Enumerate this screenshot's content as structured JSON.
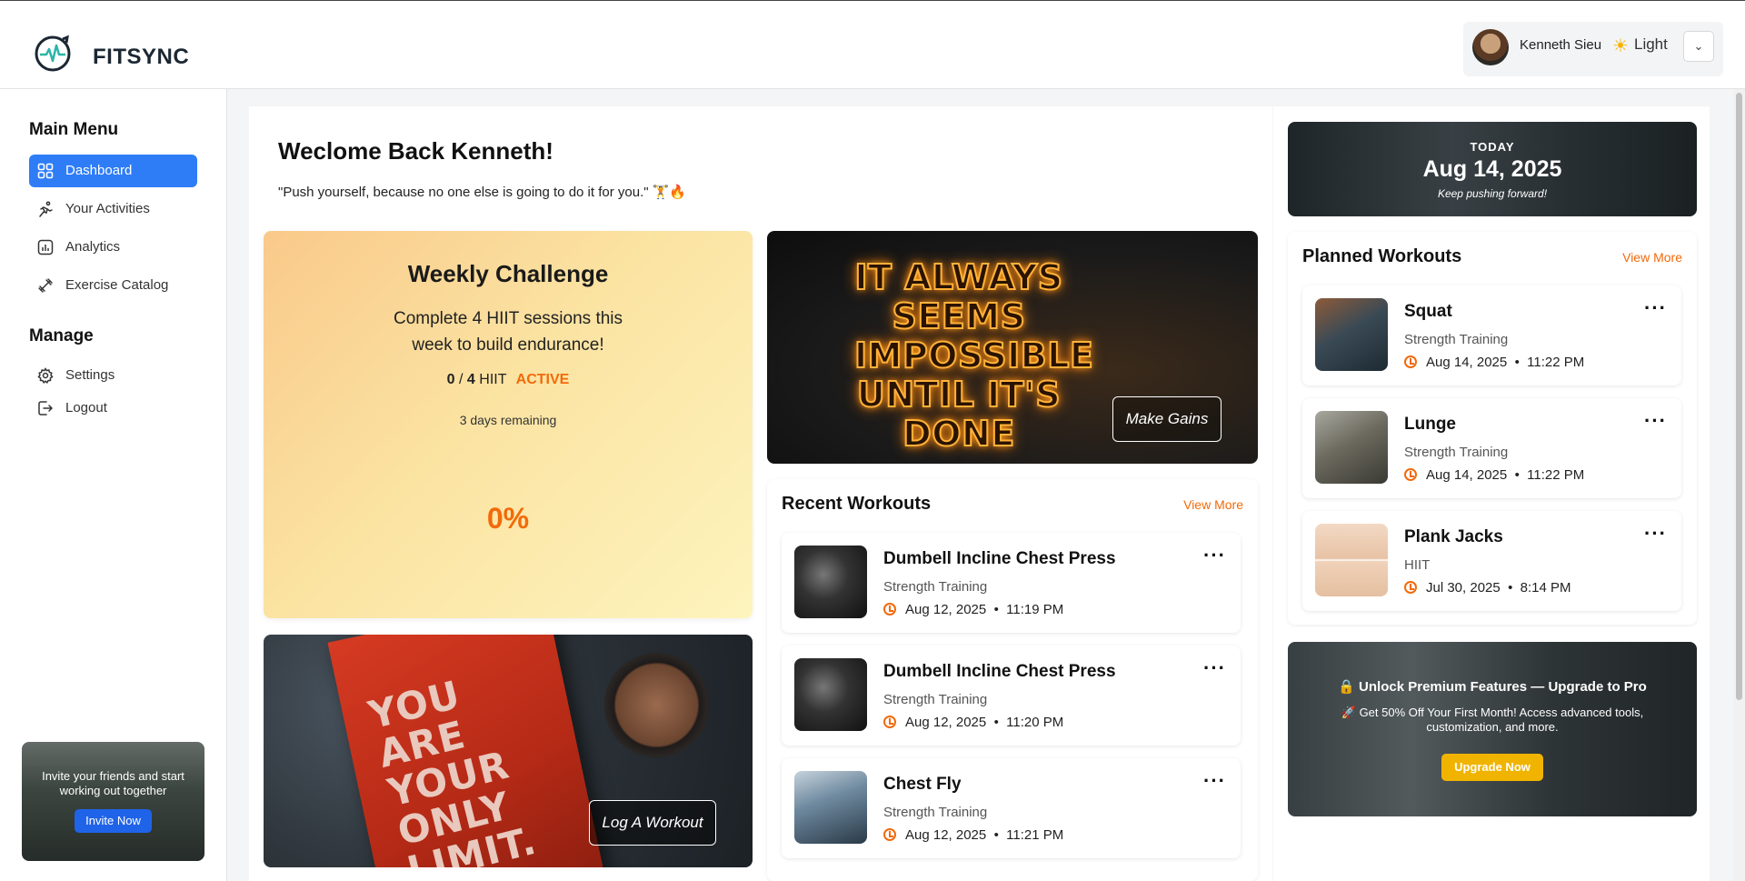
{
  "app": {
    "brand": "FITSYNC"
  },
  "user": {
    "name": "Kenneth Sieu",
    "theme_label": "Light"
  },
  "sidebar": {
    "main_heading": "Main Menu",
    "main_items": [
      {
        "label": "Dashboard",
        "icon": "grid-icon",
        "active": true
      },
      {
        "label": "Your Activities",
        "icon": "running-icon"
      },
      {
        "label": "Analytics",
        "icon": "analytics-icon"
      },
      {
        "label": "Exercise Catalog",
        "icon": "dumbbell-icon"
      }
    ],
    "manage_heading": "Manage",
    "manage_items": [
      {
        "label": "Settings",
        "icon": "gear-icon"
      },
      {
        "label": "Logout",
        "icon": "logout-icon"
      }
    ],
    "invite": {
      "text": "Invite your friends and start working out together",
      "button": "Invite Now"
    }
  },
  "main": {
    "welcome": "Weclome Back Kenneth!",
    "quote": "\"Push yourself, because no one else is going to do it for you.\" 🏋️🔥",
    "challenge": {
      "title": "Weekly Challenge",
      "description": "Complete 4 HIIT sessions this week to build endurance!",
      "done": "0",
      "sep": "/",
      "total": "4",
      "type": "HIIT",
      "status": "ACTIVE",
      "remaining": "3 days remaining",
      "percent": "0%"
    },
    "motivation_banner": {
      "text": "IT ALWAYS SEEMS IMPOSSIBLE UNTIL IT'S DONE",
      "button": "Make Gains"
    },
    "limit_banner": {
      "text": "YOU ARE YOUR ONLY LIMIT.",
      "button": "Log A Workout"
    },
    "recent": {
      "title": "Recent Workouts",
      "view_more": "View More",
      "items": [
        {
          "name": "Dumbell Incline Chest Press",
          "category": "Strength Training",
          "date": "Aug 12, 2025",
          "time": "11:19 PM"
        },
        {
          "name": "Dumbell Incline Chest Press",
          "category": "Strength Training",
          "date": "Aug 12, 2025",
          "time": "11:20 PM"
        },
        {
          "name": "Chest Fly",
          "category": "Strength Training",
          "date": "Aug 12, 2025",
          "time": "11:21 PM"
        }
      ]
    }
  },
  "right": {
    "today_label": "TODAY",
    "today_date": "Aug 14, 2025",
    "today_sub": "Keep pushing forward!",
    "planned": {
      "title": "Planned Workouts",
      "view_more": "View More",
      "items": [
        {
          "name": "Squat",
          "category": "Strength Training",
          "date": "Aug 14, 2025",
          "time": "11:22 PM"
        },
        {
          "name": "Lunge",
          "category": "Strength Training",
          "date": "Aug 14, 2025",
          "time": "11:22 PM"
        },
        {
          "name": "Plank Jacks",
          "category": "HIIT",
          "date": "Jul 30, 2025",
          "time": "8:14 PM"
        }
      ]
    },
    "premium": {
      "title": "🔒 Unlock Premium Features — Upgrade to Pro",
      "description": "🚀 Get 50% Off Your First Month! Access advanced tools, customization, and more.",
      "button": "Upgrade Now"
    }
  },
  "colors": {
    "accent": "#2e7df7",
    "orange": "#f26a0a",
    "gold": "#f0b400"
  }
}
